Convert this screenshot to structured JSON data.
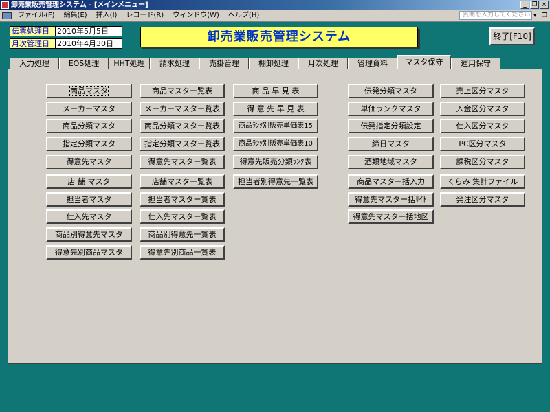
{
  "titlebar": {
    "title": "卸売業販売管理システム - [メインメニュー]"
  },
  "menubar": {
    "items": [
      "ファイル(F)",
      "編集(E)",
      "挿入(I)",
      "レコード(R)",
      "ウィンドウ(W)",
      "ヘルプ(H)"
    ],
    "help_placeholder": "質問を入力してください"
  },
  "info": {
    "voucher_label": "伝票処理日",
    "voucher_date": "2010年5月5日",
    "monthly_label": "月次管理日",
    "monthly_date": "2010年4月30日"
  },
  "system_title": "卸売業販売管理システム",
  "exit_label": "終了[F10]",
  "tabs": [
    "入力処理",
    "EOS処理",
    "HHT処理",
    "請求処理",
    "売掛管理",
    "棚卸処理",
    "月次処理",
    "管理資料",
    "マスタ保守",
    "運用保守"
  ],
  "active_tab": "マスタ保守",
  "columns": [
    [
      "商品マスタ",
      "メーカーマスタ",
      "商品分類マスタ",
      "指定分類マスタ",
      "得意先マスタ",
      "店 舗 マスタ",
      "担当者マスタ",
      "仕入先マスタ",
      "商品別得意先マスタ",
      "得意先別商品マスタ"
    ],
    [
      "商品マスター覧表",
      "メーカーマスター覧表",
      "商品分類マスター覧表",
      "指定分類マスター覧表",
      "得意先マスター覧表",
      "店舗マスター覧表",
      "担当者マスター覧表",
      "仕入先マスター覧表",
      "商品別得意先一覧表",
      "得意先別商品一覧表"
    ],
    [
      "商 品 早 見 表",
      "得 意 先 早 見 表",
      "商品ﾗﾝｸ別販売単価表15",
      "商品ﾗﾝｸ別販売単価表10",
      "得意先販売分類ﾗﾝｸ表",
      "担当者別得意先一覧表"
    ],
    [
      "伝発分類マスタ",
      "単価ランクマスタ",
      "伝発指定分類設定",
      "締日マスタ",
      "酒類地域マスタ",
      "商品マスター括入力",
      "得意先マスター括ｻｲﾄ",
      "得意先マスター括地区"
    ],
    [
      "売上区分マスタ",
      "入金区分マスタ",
      "仕入区分マスタ",
      "PC区分マスタ",
      "課税区分マスタ",
      "くらみ 集計ファイル",
      "発注区分マスタ"
    ]
  ],
  "colors": {
    "background": "#0f7575",
    "label_text": "#0000cc",
    "title_yellow": "#ffff66"
  }
}
